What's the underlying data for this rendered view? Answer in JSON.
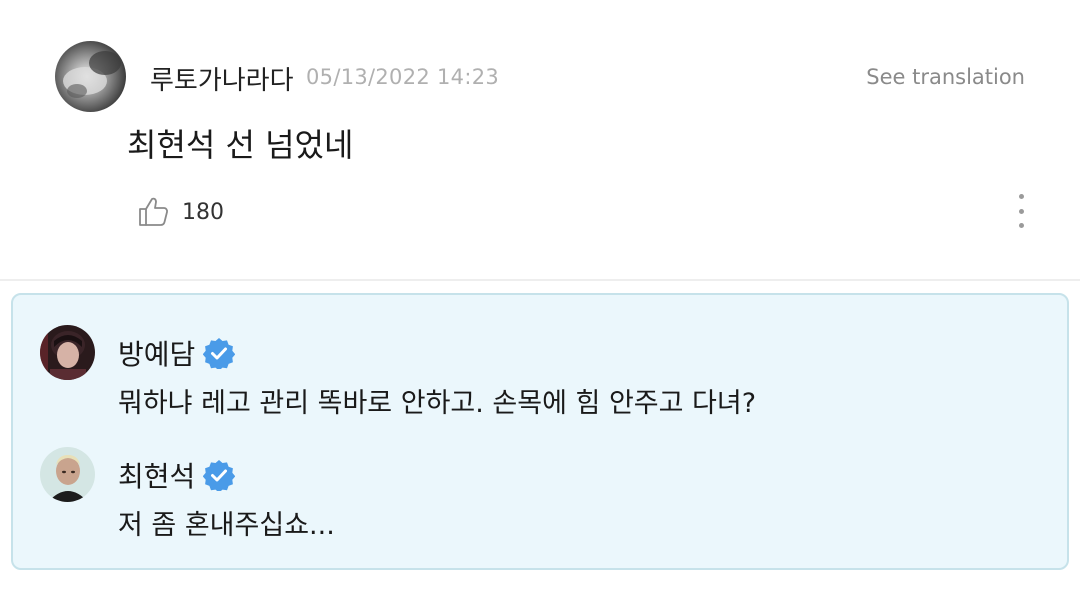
{
  "comment": {
    "author": "루토가나라다",
    "timestamp": "05/13/2022 14:23",
    "see_translation": "See translation",
    "text": "최현석 선 넘었네",
    "likes": "180",
    "icons": {
      "like": "thumbs-up-icon",
      "more": "more-vertical-icon"
    }
  },
  "replies": [
    {
      "name": "방예담",
      "verified": true,
      "text": "뭐하냐 레고 관리 똑바로 안하고. 손목에 힘 안주고 다녀?"
    },
    {
      "name": "최현석",
      "verified": true,
      "text": "저 좀 혼내주십쇼..."
    }
  ],
  "colors": {
    "reply_box_bg": "#ebf7fc",
    "reply_box_border": "#c6e2ea",
    "verified_badge": "#4a9be8",
    "timestamp": "#b0b0b0"
  }
}
